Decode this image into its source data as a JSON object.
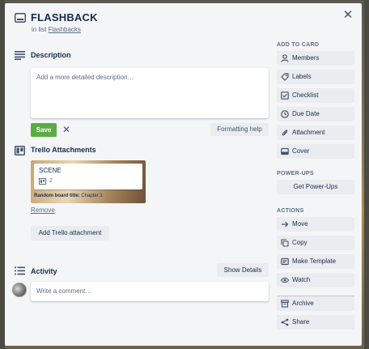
{
  "card": {
    "title": "FLASHBACK",
    "in_list_prefix": "in list",
    "list_name": "Flashbacks"
  },
  "description": {
    "heading": "Description",
    "placeholder": "Add a more detailed description…",
    "save_label": "Save",
    "formatting_help": "Formatting help"
  },
  "attachments": {
    "heading": "Trello Attachments",
    "card_name": "SCENE",
    "card_count": "2",
    "board_label": "Random board title:",
    "board_value": "Chapter 1",
    "remove_label": "Remove",
    "add_label": "Add Trello attachment"
  },
  "activity": {
    "heading": "Activity",
    "show_details": "Show Details",
    "comment_placeholder": "Write a comment…"
  },
  "sidebar": {
    "add_to_card_heading": "ADD TO CARD",
    "add_to_card": [
      {
        "label": "Members",
        "icon": "person-icon"
      },
      {
        "label": "Labels",
        "icon": "tag-icon"
      },
      {
        "label": "Checklist",
        "icon": "checklist-icon"
      },
      {
        "label": "Due Date",
        "icon": "clock-icon"
      },
      {
        "label": "Attachment",
        "icon": "paperclip-icon"
      },
      {
        "label": "Cover",
        "icon": "cover-icon"
      }
    ],
    "power_ups_heading": "POWER-UPS",
    "get_power_ups": "Get Power-Ups",
    "actions_heading": "ACTIONS",
    "actions": [
      {
        "label": "Move",
        "icon": "arrow-right-icon"
      },
      {
        "label": "Copy",
        "icon": "copy-icon"
      },
      {
        "label": "Make Template",
        "icon": "template-icon"
      },
      {
        "label": "Watch",
        "icon": "eye-icon"
      },
      {
        "label": "Archive",
        "icon": "archive-icon"
      },
      {
        "label": "Share",
        "icon": "share-icon"
      }
    ]
  },
  "colors": {
    "save_button": "#5aac44",
    "modal_background": "#f4f5f7",
    "button_background": "#ebecf0"
  }
}
